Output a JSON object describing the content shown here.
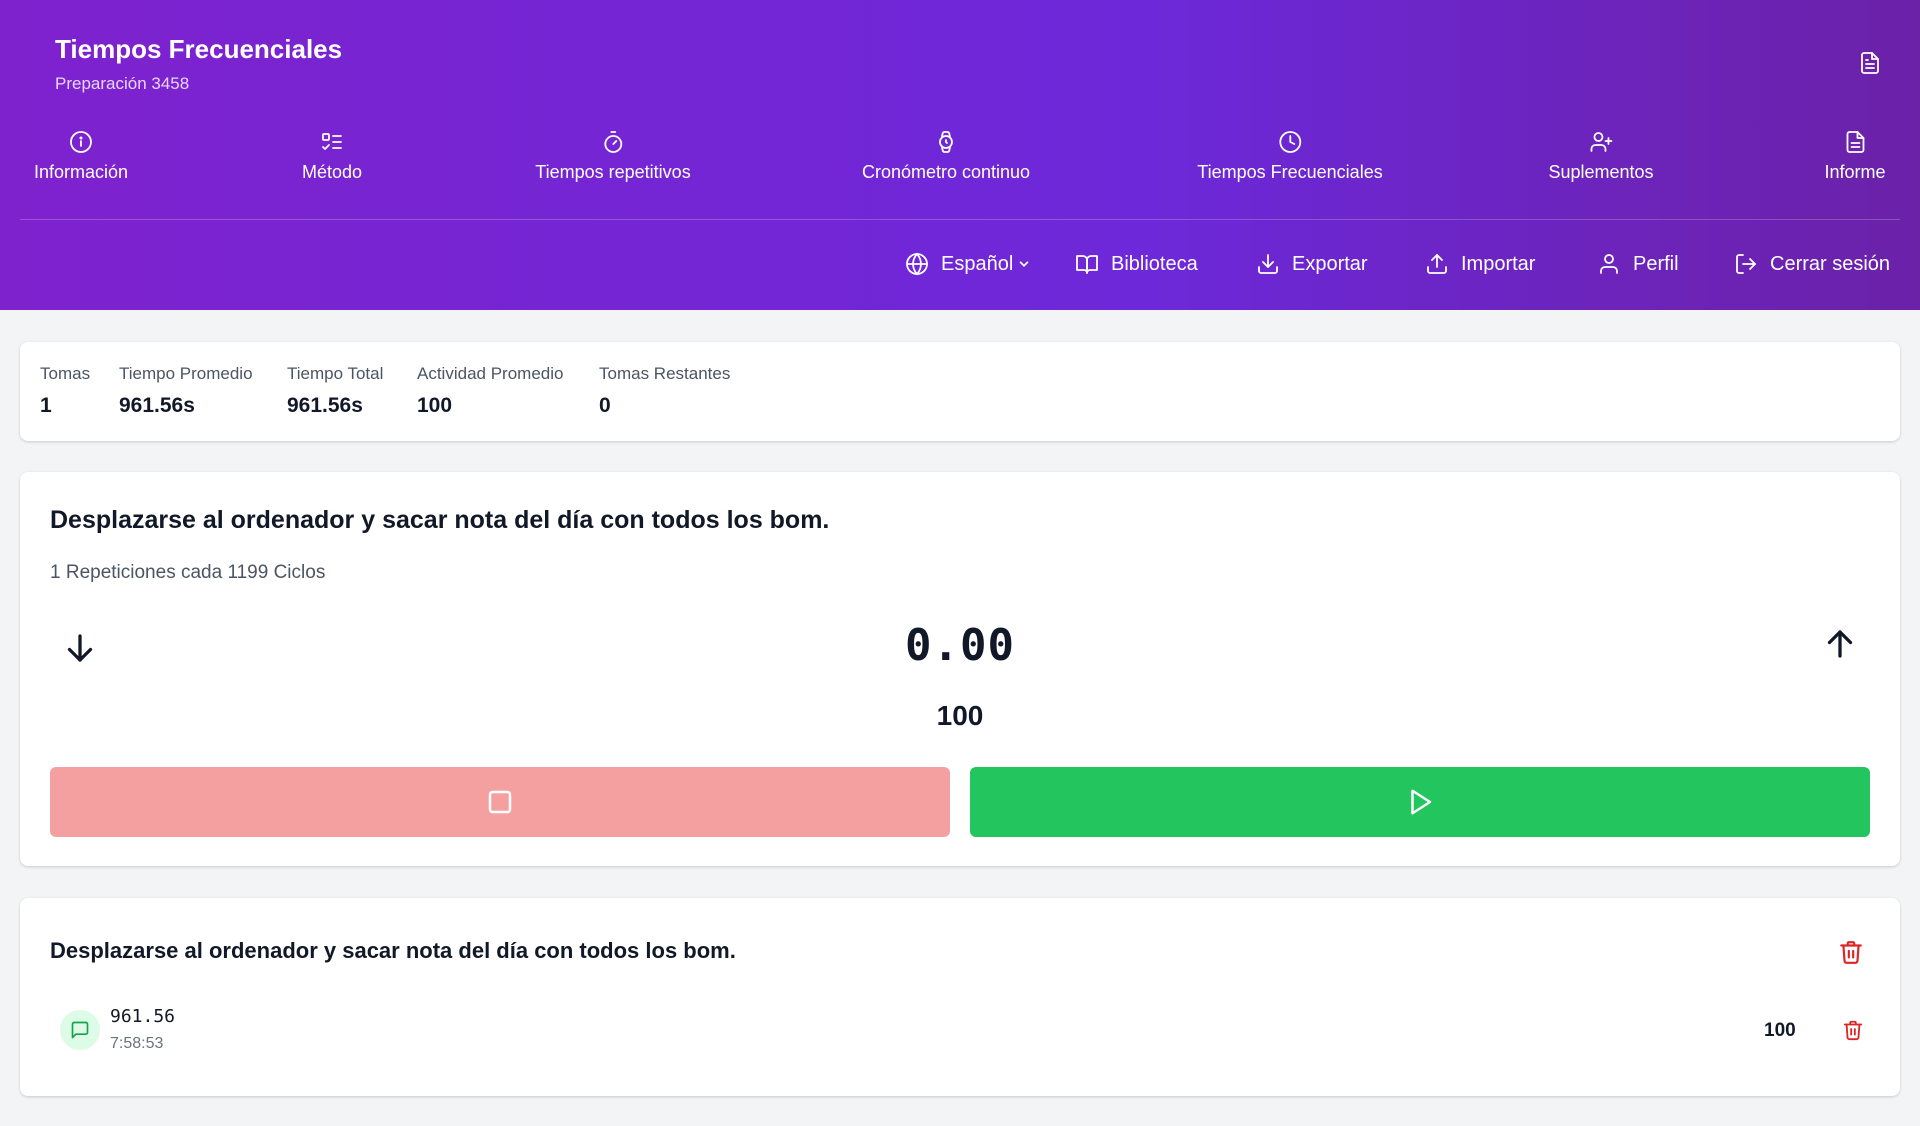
{
  "header": {
    "title": "Tiempos Frecuenciales",
    "subtitle": "Preparación 3458",
    "report_icon": "document-icon"
  },
  "nav": [
    {
      "label": "Información",
      "icon": "info-icon"
    },
    {
      "label": "Método",
      "icon": "list-check-icon"
    },
    {
      "label": "Tiempos repetitivos",
      "icon": "timer-icon"
    },
    {
      "label": "Cronómetro continuo",
      "icon": "watch-icon"
    },
    {
      "label": "Tiempos Frecuenciales",
      "icon": "clock-icon"
    },
    {
      "label": "Suplementos",
      "icon": "user-plus-icon"
    },
    {
      "label": "Informe",
      "icon": "document-icon"
    }
  ],
  "toolbar": {
    "language": "Español",
    "library": "Biblioteca",
    "export": "Exportar",
    "import": "Importar",
    "profile": "Perfil",
    "logout": "Cerrar sesión"
  },
  "stats": [
    {
      "label": "Tomas",
      "value": "1"
    },
    {
      "label": "Tiempo Promedio",
      "value": "961.56s"
    },
    {
      "label": "Tiempo Total",
      "value": "961.56s"
    },
    {
      "label": "Actividad Promedio",
      "value": "100"
    },
    {
      "label": "Tomas Restantes",
      "value": "0"
    }
  ],
  "timer": {
    "task": "Desplazarse al ordenador y sacar nota del día con todos los bom.",
    "repetitions": "1 Repeticiones cada 1199 Ciclos",
    "time": "0.00",
    "activity": "100"
  },
  "records": {
    "title": "Desplazarse al ordenador y sacar nota del día con todos los bom.",
    "items": [
      {
        "time": "961.56",
        "timestamp": "7:58:53",
        "activity": "100"
      }
    ]
  },
  "colors": {
    "header_start": "#7e22ce",
    "header_end": "#6b21a8",
    "stop_button": "#f5a0a0",
    "play_button": "#22c55e",
    "delete": "#dc2626"
  }
}
